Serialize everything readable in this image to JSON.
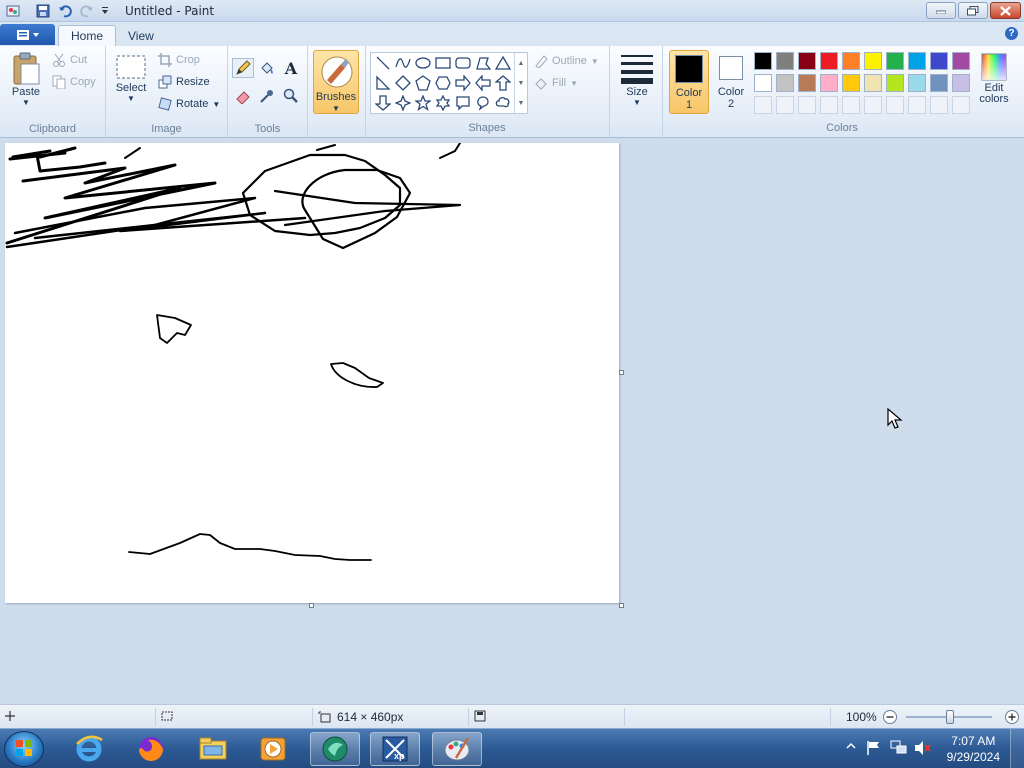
{
  "window": {
    "title": "Untitled - Paint"
  },
  "tabs": {
    "home": "Home",
    "view": "View"
  },
  "clipboard": {
    "paste": "Paste",
    "cut": "Cut",
    "copy": "Copy",
    "label": "Clipboard"
  },
  "image": {
    "select": "Select",
    "crop": "Crop",
    "resize": "Resize",
    "rotate": "Rotate",
    "label": "Image"
  },
  "tools": {
    "label": "Tools",
    "text_glyph": "A"
  },
  "brushes": {
    "label": "Brushes"
  },
  "shapes": {
    "outline": "Outline",
    "fill": "Fill",
    "label": "Shapes"
  },
  "size": {
    "label": "Size"
  },
  "colors": {
    "color1_label": "Color",
    "color1_num": "1",
    "color2_label": "Color",
    "color2_num": "2",
    "edit_label": "Edit",
    "edit_label2": "colors",
    "label": "Colors",
    "color1": "#000000",
    "color2": "#ffffff",
    "palette_row1": [
      "#000000",
      "#7f7f7f",
      "#880015",
      "#ed1c24",
      "#ff7f27",
      "#fff200",
      "#22b14c",
      "#00a2e8",
      "#3f48cc",
      "#a349a4"
    ],
    "palette_row2": [
      "#ffffff",
      "#c3c3c3",
      "#b97a57",
      "#ffaec9",
      "#ffc90e",
      "#efe4b0",
      "#b5e61d",
      "#99d9ea",
      "#7092be",
      "#c8bfe7"
    ]
  },
  "status": {
    "canvas_size": "614 × 460px",
    "zoom": "100%"
  },
  "taskbar": {
    "time": "7:07 AM",
    "date": "9/29/2024"
  }
}
